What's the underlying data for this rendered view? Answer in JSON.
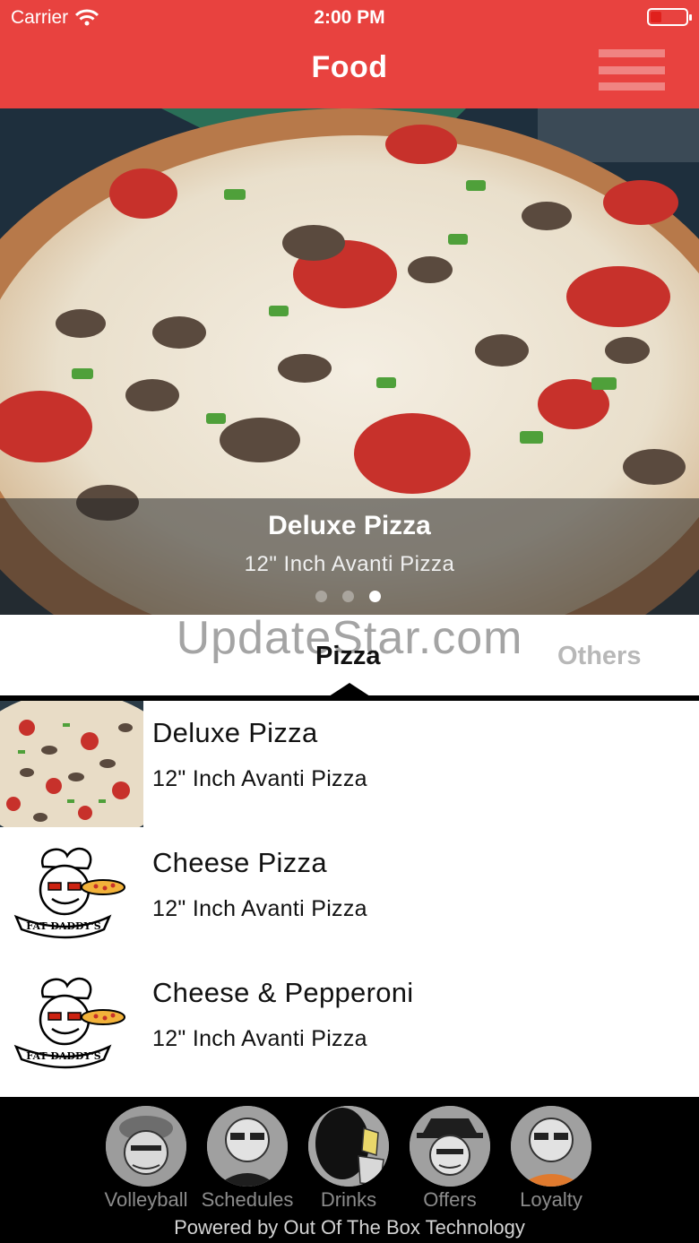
{
  "status_bar": {
    "carrier": "Carrier",
    "time": "2:00 PM"
  },
  "header": {
    "title": "Food",
    "menu_icon": "hamburger-menu-icon",
    "background_color": "#e8423f"
  },
  "hero": {
    "title": "Deluxe Pizza",
    "subtitle": "12\" Inch Avanti Pizza",
    "slide_count": 3,
    "active_slide": 3
  },
  "watermark": "UpdateStar.com",
  "tabs": [
    {
      "label": "Pizza",
      "active": true
    },
    {
      "label": "Others",
      "active": false
    }
  ],
  "items": [
    {
      "name": "Deluxe Pizza",
      "description": "12\" Inch Avanti Pizza",
      "image": "pizza-photo"
    },
    {
      "name": "Cheese Pizza",
      "description": "12\" Inch Avanti Pizza",
      "image": "fat-daddys-logo",
      "logo_text": "FAT DADDY'S"
    },
    {
      "name": "Cheese & Pepperoni",
      "description": "12\" Inch Avanti Pizza",
      "image": "fat-daddys-logo",
      "logo_text": "FAT DADDY'S"
    }
  ],
  "bottom_nav": [
    {
      "label": "Volleyball",
      "icon": "volleyball-avatar-icon"
    },
    {
      "label": "Schedules",
      "icon": "schedules-avatar-icon"
    },
    {
      "label": "Drinks",
      "icon": "drinks-avatar-icon"
    },
    {
      "label": "Offers",
      "icon": "offers-avatar-icon"
    },
    {
      "label": "Loyalty",
      "icon": "loyalty-avatar-icon"
    }
  ],
  "footer": {
    "powered_by": "Powered by Out Of The Box Technology"
  },
  "colors": {
    "accent": "#e8423f",
    "tab_inactive": "#b8b8b8",
    "nav_bar": "#000000"
  }
}
